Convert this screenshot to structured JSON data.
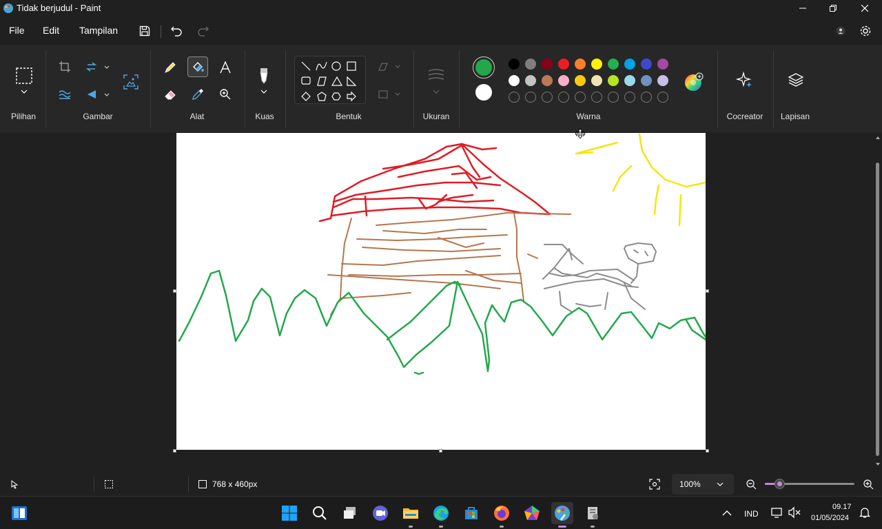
{
  "window": {
    "title": "Tidak berjudul - Paint"
  },
  "menu": {
    "file": "File",
    "edit": "Edit",
    "view": "Tampilan"
  },
  "ribbon": {
    "groups": {
      "selection": "Pilihan",
      "image": "Gambar",
      "tools": "Alat",
      "brushes": "Kuas",
      "shapes": "Bentuk",
      "size": "Ukuran",
      "colors": "Warna",
      "cocreator": "Cocreator",
      "layers": "Lapisan"
    },
    "primary_color": "#22a84a",
    "secondary_color": "#ffffff",
    "palette_row1": [
      "#000000",
      "#7f7f7f",
      "#880015",
      "#ed1c24",
      "#ff7f27",
      "#fff200",
      "#22b14c",
      "#00a2e8",
      "#3f48cc",
      "#a349a4"
    ],
    "palette_row2": [
      "#ffffff",
      "#c3c3c3",
      "#b97a57",
      "#ffaec9",
      "#ffc90e",
      "#efe4b0",
      "#b5e61d",
      "#99d9ea",
      "#7092be",
      "#c8bfe7"
    ]
  },
  "status": {
    "canvas_size": "768 x 460px",
    "zoom": "100%"
  },
  "taskbar": {
    "language": "IND",
    "time": "09.17",
    "date": "01/05/2024"
  }
}
